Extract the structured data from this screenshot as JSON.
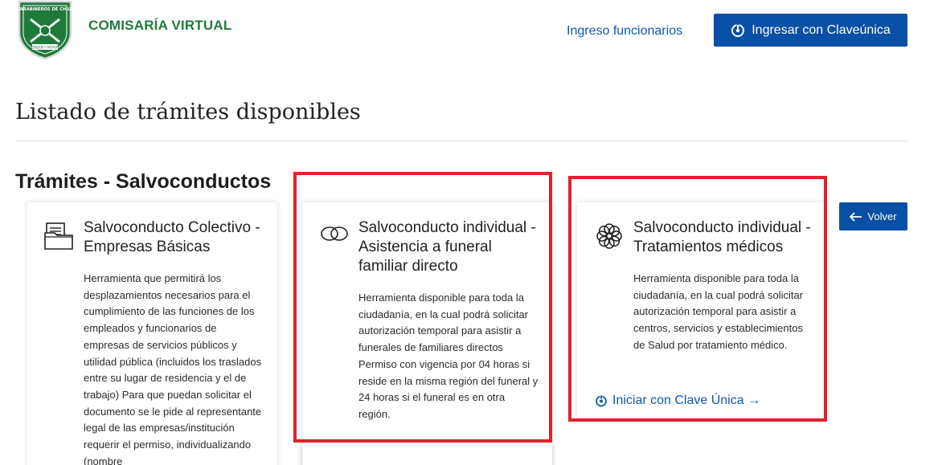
{
  "header": {
    "brand": "COMISARÍA VIRTUAL",
    "logo_top_text": "CARABINEROS DE CHILE",
    "logo_bottom_text": "ORDEN Y PATRIA",
    "staff_link": "Ingreso funcionarios",
    "login_button": "Ingresar con Claveúnica"
  },
  "page": {
    "title": "Listado de trámites disponibles",
    "section_title": "Trámites - Salvoconductos",
    "back_button": "Volver"
  },
  "cards": [
    {
      "icon": "folder-documents-icon",
      "title": "Salvoconducto Colectivo - Empresas Básicas",
      "description": "Herramienta que permitirá los desplazamientos necesarios para el cumplimiento de las funciones de los empleados y funcionarios de empresas de servicios públicos y utilidad pública (incluidos los traslados entre su lugar de residencia y el de trabajo) Para que puedan solicitar el documento se le pide al representante legal de las empresas/institución requerir el permiso, individualizando (nombre"
    },
    {
      "icon": "infinity-rings-icon",
      "title": "Salvoconducto individual - Asistencia a funeral familiar directo",
      "description": "Herramienta disponible para toda la ciudadanía, en la cual podrá solicitar autorización temporal para asistir a funerales de familiares directos Permiso con vigencia por 04 horas si reside en la misma región del funeral y 24 horas si el funeral es en otra región."
    },
    {
      "icon": "medical-flower-icon",
      "title": "Salvoconducto individual - Tratamientos médicos",
      "description": "Herramienta disponible para toda la ciudadanía, en la cual podrá solicitar autorización temporal para asistir a centros, servicios y establecimientos de Salud por tratamiento médico.",
      "start_link": "Iniciar con Clave Única →"
    }
  ],
  "colors": {
    "brand_green": "#1f7a3a",
    "primary_blue": "#0a4fa6",
    "link_blue": "#0f5aa8",
    "highlight_red": "#e0212e"
  }
}
